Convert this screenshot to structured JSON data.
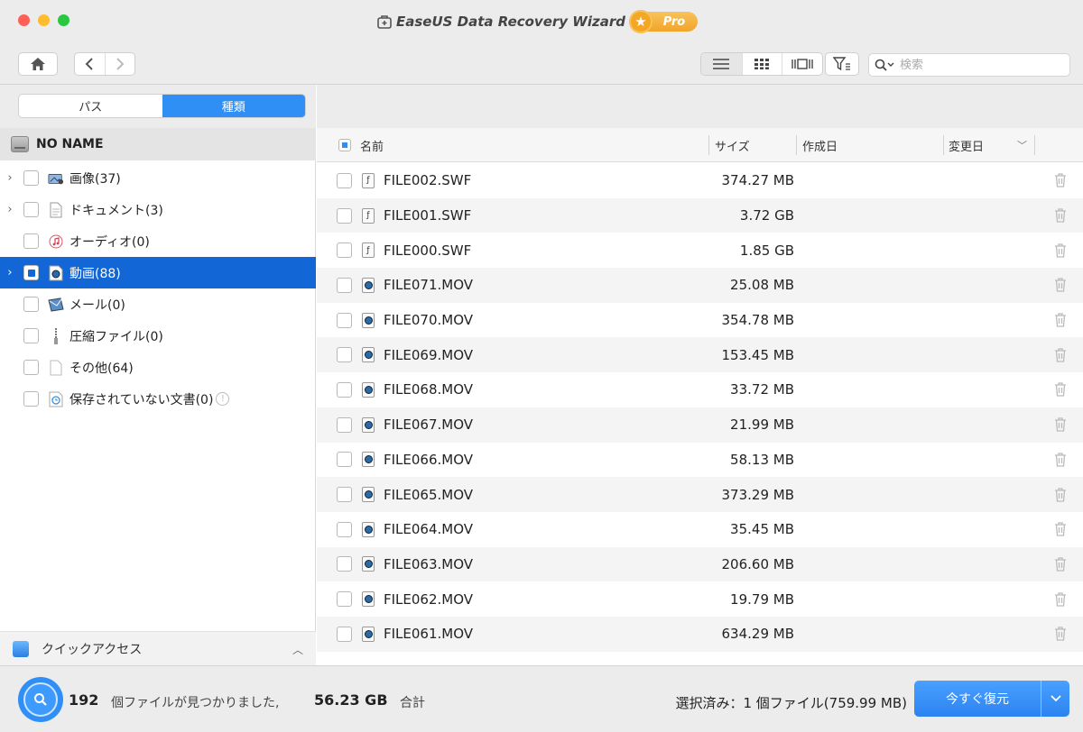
{
  "window": {
    "title": "EaseUS Data Recovery Wizard",
    "badge": "Pro"
  },
  "toolbar": {
    "search_placeholder": "検索"
  },
  "tabs": [
    {
      "label": "パス",
      "active": false
    },
    {
      "label": "種類",
      "active": true
    }
  ],
  "drive": {
    "name": "NO NAME"
  },
  "tree": [
    {
      "label": "画像(37)",
      "expandable": true,
      "selected": false,
      "icon": "photo-icon"
    },
    {
      "label": "ドキュメント(3)",
      "expandable": true,
      "selected": false,
      "icon": "document-icon"
    },
    {
      "label": "オーディオ(0)",
      "expandable": false,
      "selected": false,
      "icon": "music-icon"
    },
    {
      "label": "動画(88)",
      "expandable": true,
      "selected": true,
      "icon": "video-icon"
    },
    {
      "label": "メール(0)",
      "expandable": false,
      "selected": false,
      "icon": "mail-icon"
    },
    {
      "label": "圧縮ファイル(0)",
      "expandable": false,
      "selected": false,
      "icon": "archive-icon"
    },
    {
      "label": "その他(64)",
      "expandable": false,
      "selected": false,
      "icon": "file-icon"
    },
    {
      "label": "保存されていない文書(0)",
      "expandable": false,
      "selected": false,
      "icon": "clock-doc-icon",
      "warning": true
    }
  ],
  "quick_access": {
    "label": "クイックアクセス"
  },
  "columns": {
    "name": "名前",
    "size": "サイズ",
    "created": "作成日",
    "modified": "変更日"
  },
  "files": [
    {
      "name": "FILE002.SWF",
      "size": "374.27 MB",
      "type": "swf"
    },
    {
      "name": "FILE001.SWF",
      "size": "3.72 GB",
      "type": "swf"
    },
    {
      "name": "FILE000.SWF",
      "size": "1.85 GB",
      "type": "swf"
    },
    {
      "name": "FILE071.MOV",
      "size": "25.08 MB",
      "type": "mov"
    },
    {
      "name": "FILE070.MOV",
      "size": "354.78 MB",
      "type": "mov"
    },
    {
      "name": "FILE069.MOV",
      "size": "153.45 MB",
      "type": "mov"
    },
    {
      "name": "FILE068.MOV",
      "size": "33.72 MB",
      "type": "mov"
    },
    {
      "name": "FILE067.MOV",
      "size": "21.99 MB",
      "type": "mov"
    },
    {
      "name": "FILE066.MOV",
      "size": "58.13 MB",
      "type": "mov"
    },
    {
      "name": "FILE065.MOV",
      "size": "373.29 MB",
      "type": "mov"
    },
    {
      "name": "FILE064.MOV",
      "size": "35.45 MB",
      "type": "mov"
    },
    {
      "name": "FILE063.MOV",
      "size": "206.60 MB",
      "type": "mov"
    },
    {
      "name": "FILE062.MOV",
      "size": "19.79 MB",
      "type": "mov"
    },
    {
      "name": "FILE061.MOV",
      "size": "634.29 MB",
      "type": "mov"
    }
  ],
  "status": {
    "file_count": "192",
    "count_text": "個ファイルが見つかりました,",
    "total_size": "56.23 GB",
    "total_text": "合計",
    "selected_text": "選択済み：1 個ファイル(759.99 MB)"
  },
  "recover_button": {
    "label": "今すぐ復元"
  },
  "colors": {
    "accent": "#2f8ff5",
    "selected_row": "#1266d6"
  }
}
